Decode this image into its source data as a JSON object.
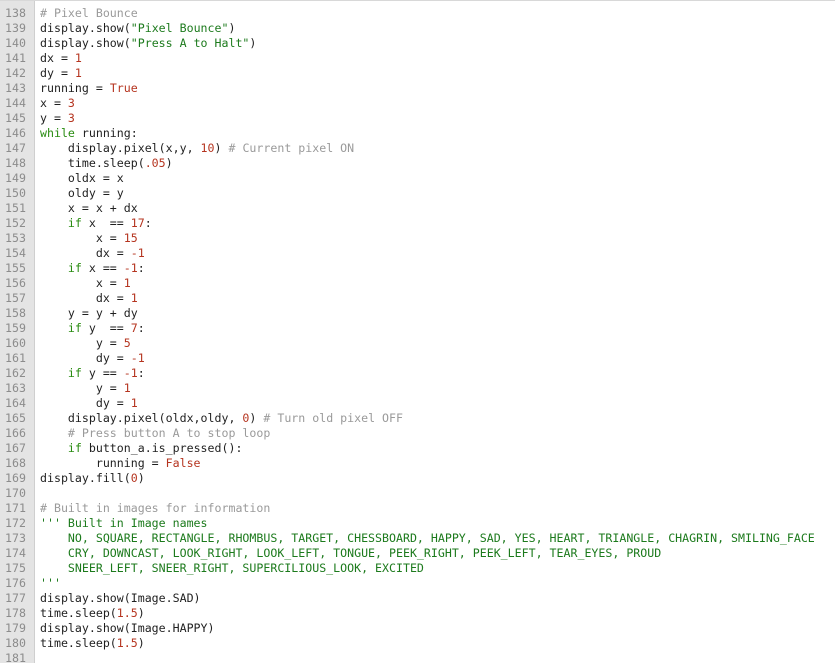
{
  "colors": {
    "comment": "#9a9a9a",
    "keyword": "#2a8c12",
    "string": "#1c7a1c",
    "number": "#b5341f",
    "text": "#1f1f1f",
    "gutter_bg": "#e4e4e4",
    "line_number": "#8c8c8c"
  },
  "lines": [
    {
      "n": "138",
      "tokens": [
        [
          "cm",
          "# Pixel Bounce"
        ]
      ]
    },
    {
      "n": "139",
      "tokens": [
        [
          "tx",
          "display.show("
        ],
        [
          "st",
          "\"Pixel Bounce\""
        ],
        [
          "tx",
          ")"
        ]
      ]
    },
    {
      "n": "140",
      "tokens": [
        [
          "tx",
          "display.show("
        ],
        [
          "st",
          "\"Press A to Halt\""
        ],
        [
          "tx",
          ")"
        ]
      ]
    },
    {
      "n": "141",
      "tokens": [
        [
          "tx",
          "dx = "
        ],
        [
          "nm",
          "1"
        ]
      ]
    },
    {
      "n": "142",
      "tokens": [
        [
          "tx",
          "dy = "
        ],
        [
          "nm",
          "1"
        ]
      ]
    },
    {
      "n": "143",
      "tokens": [
        [
          "tx",
          "running = "
        ],
        [
          "nm",
          "True"
        ]
      ]
    },
    {
      "n": "144",
      "tokens": [
        [
          "tx",
          "x = "
        ],
        [
          "nm",
          "3"
        ]
      ]
    },
    {
      "n": "145",
      "tokens": [
        [
          "tx",
          "y = "
        ],
        [
          "nm",
          "3"
        ]
      ]
    },
    {
      "n": "146",
      "tokens": [
        [
          "kw",
          "while"
        ],
        [
          "tx",
          " running:"
        ]
      ]
    },
    {
      "n": "147",
      "tokens": [
        [
          "tx",
          "    display.pixel(x,y, "
        ],
        [
          "nm",
          "10"
        ],
        [
          "tx",
          ") "
        ],
        [
          "cm",
          "# Current pixel ON"
        ]
      ]
    },
    {
      "n": "148",
      "tokens": [
        [
          "tx",
          "    time.sleep("
        ],
        [
          "nm",
          ".05"
        ],
        [
          "tx",
          ")"
        ]
      ]
    },
    {
      "n": "149",
      "tokens": [
        [
          "tx",
          "    oldx = x"
        ]
      ]
    },
    {
      "n": "150",
      "tokens": [
        [
          "tx",
          "    oldy = y"
        ]
      ]
    },
    {
      "n": "151",
      "tokens": [
        [
          "tx",
          "    x = x + dx"
        ]
      ]
    },
    {
      "n": "152",
      "tokens": [
        [
          "tx",
          "    "
        ],
        [
          "kw",
          "if"
        ],
        [
          "tx",
          " x  == "
        ],
        [
          "nm",
          "17"
        ],
        [
          "tx",
          ":"
        ]
      ]
    },
    {
      "n": "153",
      "tokens": [
        [
          "tx",
          "        x = "
        ],
        [
          "nm",
          "15"
        ]
      ]
    },
    {
      "n": "154",
      "tokens": [
        [
          "tx",
          "        dx = "
        ],
        [
          "nm",
          "-1"
        ]
      ]
    },
    {
      "n": "155",
      "tokens": [
        [
          "tx",
          "    "
        ],
        [
          "kw",
          "if"
        ],
        [
          "tx",
          " x == "
        ],
        [
          "nm",
          "-1"
        ],
        [
          "tx",
          ":"
        ]
      ]
    },
    {
      "n": "156",
      "tokens": [
        [
          "tx",
          "        x = "
        ],
        [
          "nm",
          "1"
        ]
      ]
    },
    {
      "n": "157",
      "tokens": [
        [
          "tx",
          "        dx = "
        ],
        [
          "nm",
          "1"
        ]
      ]
    },
    {
      "n": "158",
      "tokens": [
        [
          "tx",
          "    y = y + dy"
        ]
      ]
    },
    {
      "n": "159",
      "tokens": [
        [
          "tx",
          "    "
        ],
        [
          "kw",
          "if"
        ],
        [
          "tx",
          " y  == "
        ],
        [
          "nm",
          "7"
        ],
        [
          "tx",
          ":"
        ]
      ]
    },
    {
      "n": "160",
      "tokens": [
        [
          "tx",
          "        y = "
        ],
        [
          "nm",
          "5"
        ]
      ]
    },
    {
      "n": "161",
      "tokens": [
        [
          "tx",
          "        dy = "
        ],
        [
          "nm",
          "-1"
        ]
      ]
    },
    {
      "n": "162",
      "tokens": [
        [
          "tx",
          "    "
        ],
        [
          "kw",
          "if"
        ],
        [
          "tx",
          " y == "
        ],
        [
          "nm",
          "-1"
        ],
        [
          "tx",
          ":"
        ]
      ]
    },
    {
      "n": "163",
      "tokens": [
        [
          "tx",
          "        y = "
        ],
        [
          "nm",
          "1"
        ]
      ]
    },
    {
      "n": "164",
      "tokens": [
        [
          "tx",
          "        dy = "
        ],
        [
          "nm",
          "1"
        ]
      ]
    },
    {
      "n": "165",
      "tokens": [
        [
          "tx",
          "    display.pixel(oldx,oldy, "
        ],
        [
          "nm",
          "0"
        ],
        [
          "tx",
          ") "
        ],
        [
          "cm",
          "# Turn old pixel OFF"
        ]
      ]
    },
    {
      "n": "166",
      "tokens": [
        [
          "tx",
          "    "
        ],
        [
          "cm",
          "# Press button A to stop loop"
        ]
      ]
    },
    {
      "n": "167",
      "tokens": [
        [
          "tx",
          "    "
        ],
        [
          "kw",
          "if"
        ],
        [
          "tx",
          " button_a.is_pressed():"
        ]
      ]
    },
    {
      "n": "168",
      "tokens": [
        [
          "tx",
          "        running = "
        ],
        [
          "nm",
          "False"
        ]
      ]
    },
    {
      "n": "169",
      "tokens": [
        [
          "tx",
          "display.fill("
        ],
        [
          "nm",
          "0"
        ],
        [
          "tx",
          ")"
        ]
      ]
    },
    {
      "n": "170",
      "tokens": []
    },
    {
      "n": "171",
      "tokens": [
        [
          "cm",
          "# Built in images for information"
        ]
      ]
    },
    {
      "n": "172",
      "tokens": [
        [
          "st",
          "''' Built in Image names"
        ]
      ]
    },
    {
      "n": "173",
      "tokens": [
        [
          "st",
          "    NO, SQUARE, RECTANGLE, RHOMBUS, TARGET, CHESSBOARD, HAPPY, SAD, YES, HEART, TRIANGLE, CHAGRIN, SMILING_FACE"
        ]
      ]
    },
    {
      "n": "174",
      "tokens": [
        [
          "st",
          "    CRY, DOWNCAST, LOOK_RIGHT, LOOK_LEFT, TONGUE, PEEK_RIGHT, PEEK_LEFT, TEAR_EYES, PROUD"
        ]
      ]
    },
    {
      "n": "175",
      "tokens": [
        [
          "st",
          "    SNEER_LEFT, SNEER_RIGHT, SUPERCILIOUS_LOOK, EXCITED"
        ]
      ]
    },
    {
      "n": "176",
      "tokens": [
        [
          "st",
          "'''"
        ]
      ]
    },
    {
      "n": "177",
      "tokens": [
        [
          "tx",
          "display.show(Image.SAD)"
        ]
      ]
    },
    {
      "n": "178",
      "tokens": [
        [
          "tx",
          "time.sleep("
        ],
        [
          "nm",
          "1.5"
        ],
        [
          "tx",
          ")"
        ]
      ]
    },
    {
      "n": "179",
      "tokens": [
        [
          "tx",
          "display.show(Image.HAPPY)"
        ]
      ]
    },
    {
      "n": "180",
      "tokens": [
        [
          "tx",
          "time.sleep("
        ],
        [
          "nm",
          "1.5"
        ],
        [
          "tx",
          ")"
        ]
      ]
    },
    {
      "n": "181",
      "tokens": []
    }
  ]
}
